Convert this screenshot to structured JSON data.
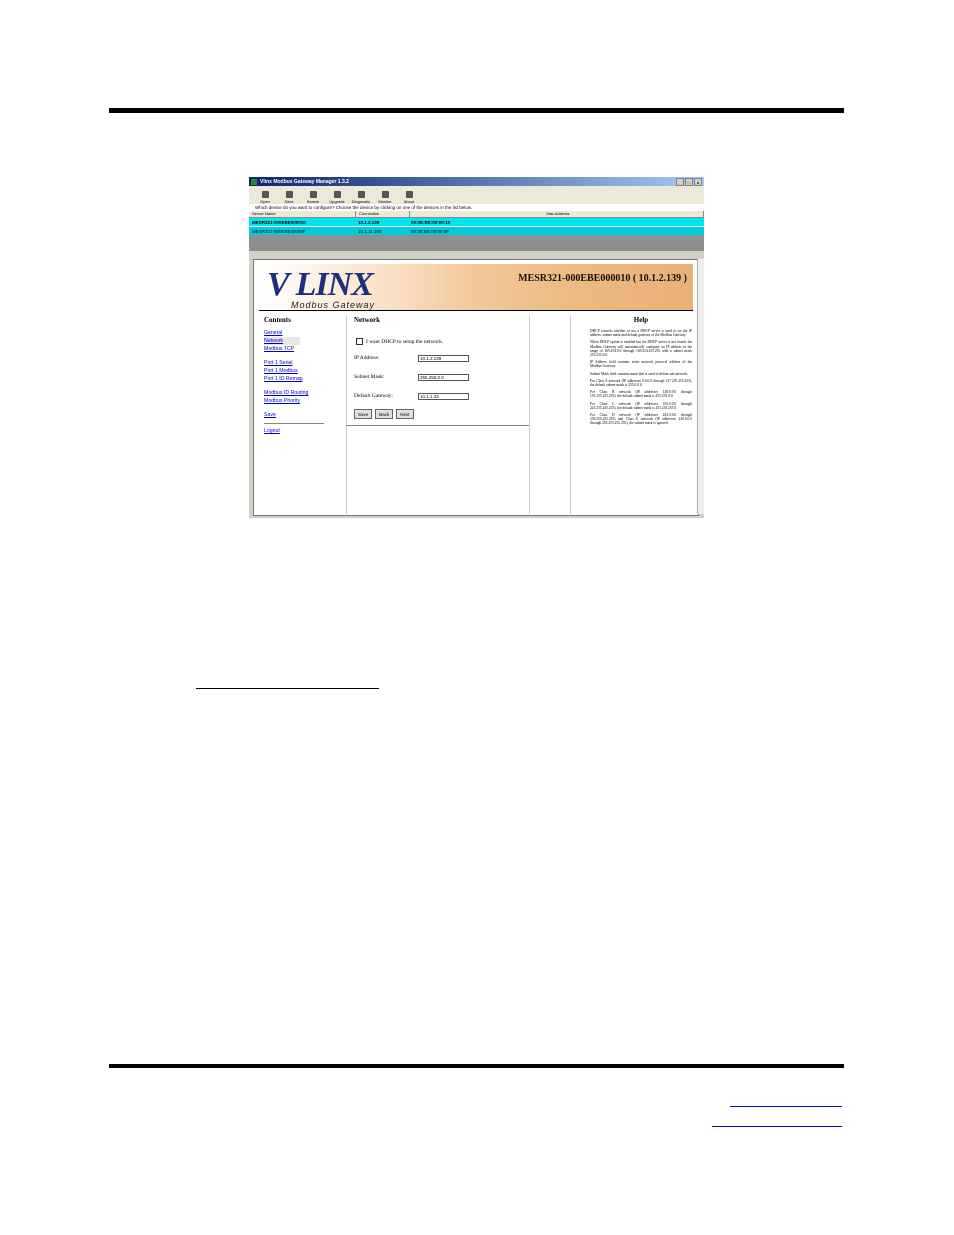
{
  "window": {
    "title": "Vlinx Modbus Gateway Manager 1.3.2",
    "controls": [
      "_",
      "□",
      "x"
    ]
  },
  "toolbar": {
    "items": [
      {
        "label": "Open",
        "icon": "folder-icon"
      },
      {
        "label": "Save",
        "icon": "floppy-icon"
      },
      {
        "label": "Search",
        "icon": "search-icon"
      },
      {
        "label": "Upgrade",
        "icon": "upgrade-icon"
      },
      {
        "label": "Diagnostic",
        "icon": "diagnostic-icon"
      },
      {
        "label": "Monitor",
        "icon": "monitor-icon"
      },
      {
        "label": "About",
        "icon": "help-icon"
      }
    ]
  },
  "device_list": {
    "prompt": "Which device do you want to configure? Choose the device by clicking on one of the devices in the list below.",
    "columns": [
      "Server Name",
      "Connection",
      "Mac Address"
    ],
    "rows": [
      {
        "name": "MESR321-000EBE000010",
        "connection": "10.1.2.139",
        "mac": "00:0E:BE:00:00:10"
      },
      {
        "name": "MESR321-000EBE00000F",
        "connection": "10.1.11.193",
        "mac": "00:0E:BE:00:00:0F"
      }
    ]
  },
  "page": {
    "logo": "V LINX",
    "logo_sub": "Modbus Gateway",
    "device_title": "MESR321-000EBE000010 ( 10.1.2.139 )",
    "contents_title": "Contents",
    "nav": {
      "general": "General",
      "network": "Network",
      "modbus_tcp": "Modbus TCP",
      "port_serial": "Port 1 Serial",
      "port_modbus": "Port 1 Modbus",
      "port_id_remap": "Port 1 ID Remap",
      "id_routing": "Modbus ID Routing",
      "priority": "Modbus Priority",
      "save": "Save",
      "logout": "Logout"
    },
    "form": {
      "title": "Network",
      "dhcp_label": "I want DHCP to setup the network.",
      "ip_label": "IP Address:",
      "ip_value": "10.1.2.139",
      "mask_label": "Subnet Mask:",
      "mask_value": "255.255.0.0",
      "gateway_label": "Default Gateway:",
      "gateway_value": "10.1.1.33",
      "save": "Save",
      "back": "Back",
      "next": "Next"
    },
    "help": {
      "title": "Help",
      "p1": "DHCP controls whether or not a DHCP server is used to set the IP address, subnet mask and default gateway of the Modbus Gateway.",
      "p2": "When DHCP option is enabled but the DHCP server is not found, the Modbus Gateway will automatically configure an IP address in the range of 169.254.0.0 through 169.254.255.255 with a subnet mask 255.255.0.0.",
      "p3": "IP Address field contains static network protocol address of the Modbus Gateway.",
      "p4": "Subnet Mask field contains mask that is used to define sub network.",
      "p5": "For Class A network (IP addresses 0.0.0.0 through 127.255.255.255), the default subnet mask is 255.0.0.0.",
      "p6": "For Class B network (IP addresses 128.0.0.0 through 191.255.255.255), the default subnet mask is 255.255.0.0.",
      "p7": "For Class C network (IP addresses 192.0.0.0 through 223.255.255.255), the default subnet mask is 255.255.255.0.",
      "p8": "For Class D network (IP addresses 224.0.0.0 through 239.255.255.255) and Class E network (IP addresses 240.0.0.0 through 255.255.255.255), the subnet mask is ignored."
    }
  }
}
